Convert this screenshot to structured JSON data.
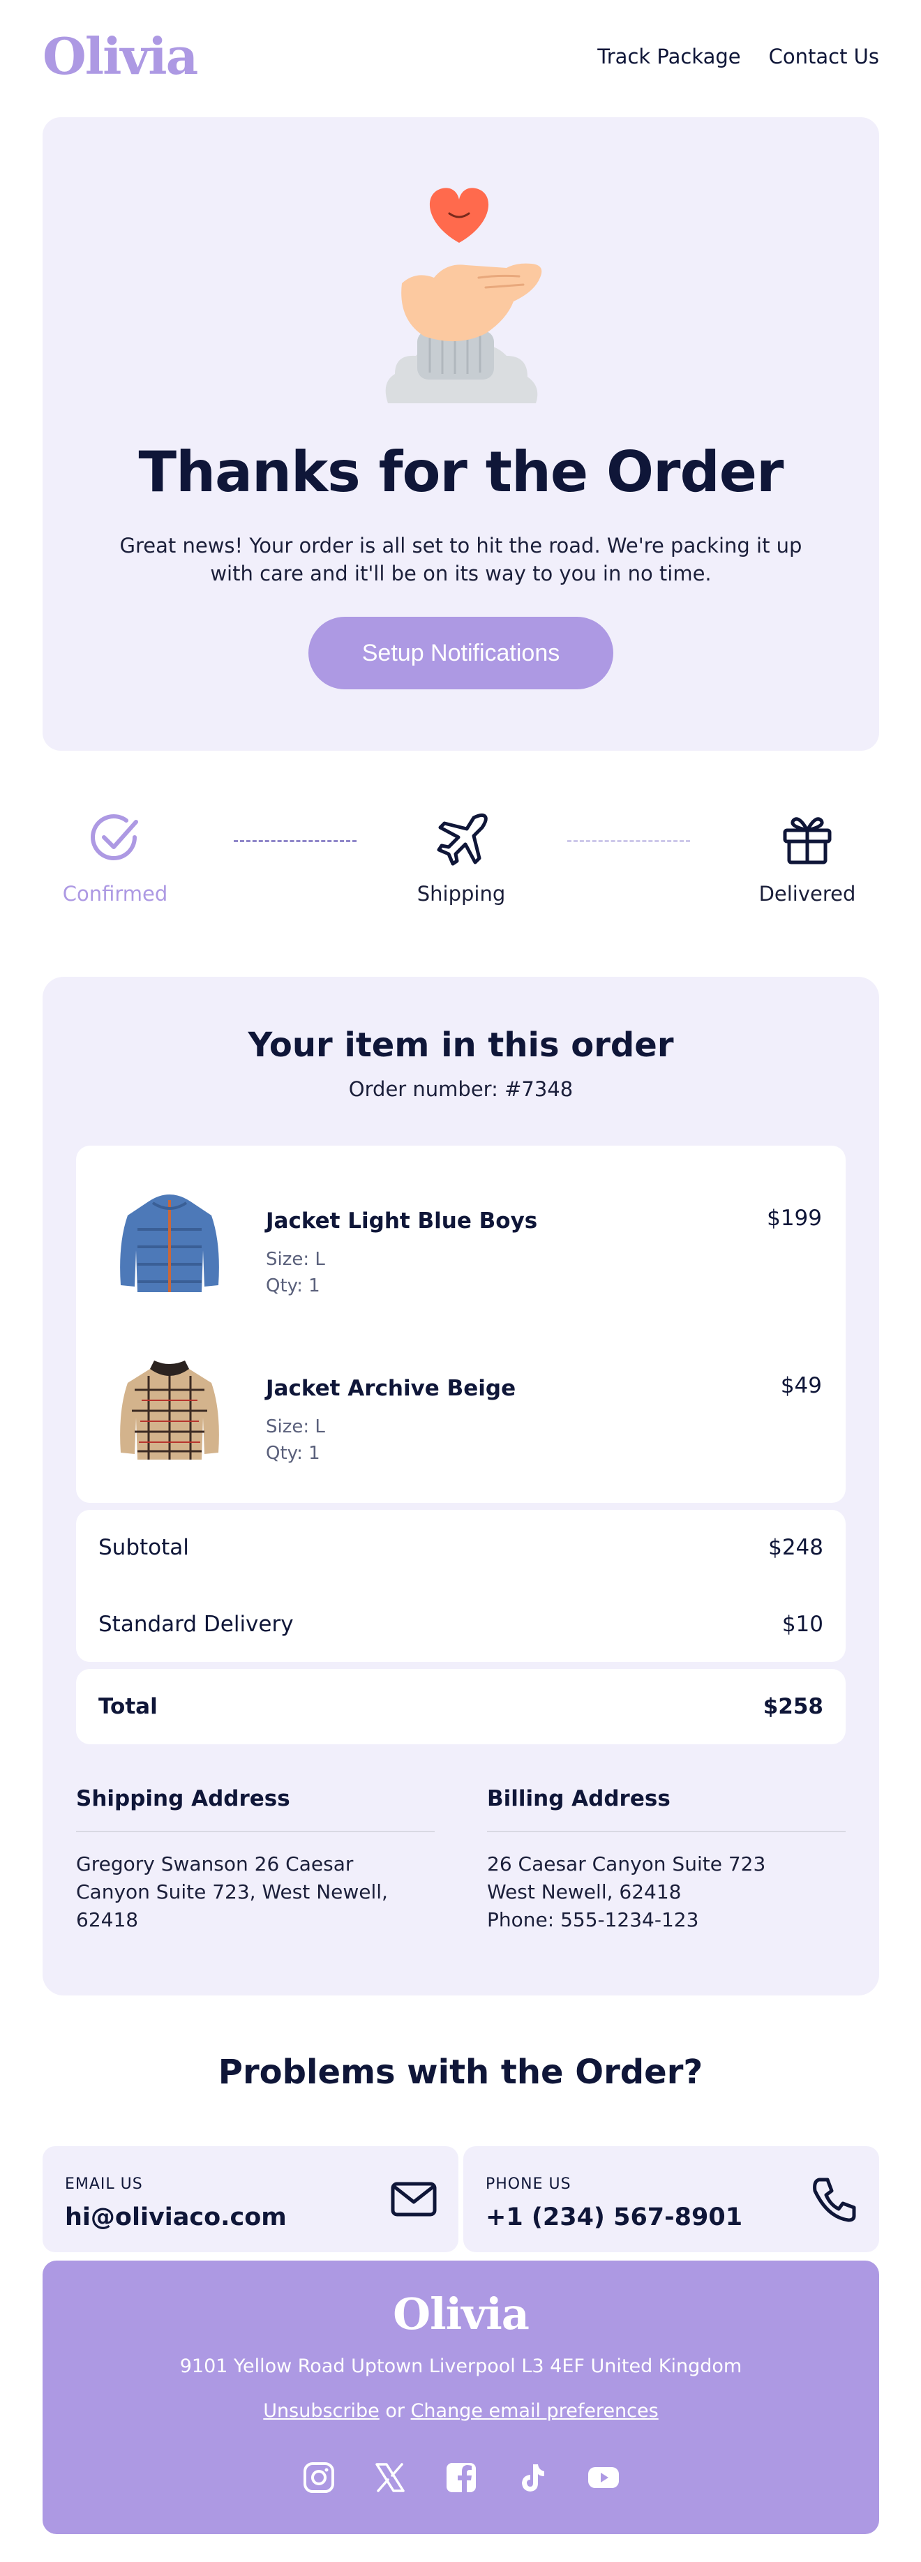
{
  "brand": {
    "name": "Olivia",
    "accent": "#ad99e3",
    "panel": "#f1effb",
    "ink": "#0f1638"
  },
  "nav": {
    "track": "Track Package",
    "contact": "Contact Us"
  },
  "hero": {
    "title": "Thanks for the Order",
    "text": "Great news! Your order is all set to hit the road. We're packing it up with care and it'll be on its way to you in no time.",
    "button": "Setup Notifications"
  },
  "steps": [
    {
      "label": "Confirmed",
      "icon": "check-circle-icon",
      "state": "active"
    },
    {
      "label": "Shipping",
      "icon": "airplane-icon",
      "state": "pending"
    },
    {
      "label": "Delivered",
      "icon": "gift-icon",
      "state": "pending"
    }
  ],
  "order": {
    "title": "Your item in this order",
    "number": "Order number: #7348",
    "items": [
      {
        "name": "Jacket Light Blue Boys",
        "size": "Size: L",
        "qty": "Qty: 1",
        "price": "$199"
      },
      {
        "name": "Jacket Archive Beige",
        "size": "Size: L",
        "qty": "Qty: 1",
        "price": "$49"
      }
    ],
    "subtotal_label": "Subtotal",
    "subtotal": "$248",
    "delivery_label": "Standard Delivery",
    "delivery": "$10",
    "total_label": "Total",
    "total": "$258"
  },
  "addresses": {
    "shipping_title": "Shipping Address",
    "shipping_lines": [
      "Gregory Swanson 26 Caesar",
      "Canyon Suite 723, West Newell,",
      "62418"
    ],
    "billing_title": "Billing Address",
    "billing_lines": [
      "26 Caesar Canyon Suite 723",
      "West Newell, 62418",
      "Phone: 555-1234-123"
    ]
  },
  "problems": {
    "title": "Problems with the Order?",
    "email_label": "EMAIL US",
    "email": "hi@oliviaco.com",
    "phone_label": "PHONE US",
    "phone": "+1 (234) 567-8901"
  },
  "footer": {
    "logo": "Olivia",
    "address": "9101 Yellow Road Uptown Liverpool L3 4EF United Kingdom",
    "unsubscribe": "Unsubscribe",
    "or": " or ",
    "preferences": "Change email preferences",
    "socials": [
      "instagram-icon",
      "x-icon",
      "facebook-icon",
      "tiktok-icon",
      "youtube-icon"
    ]
  }
}
